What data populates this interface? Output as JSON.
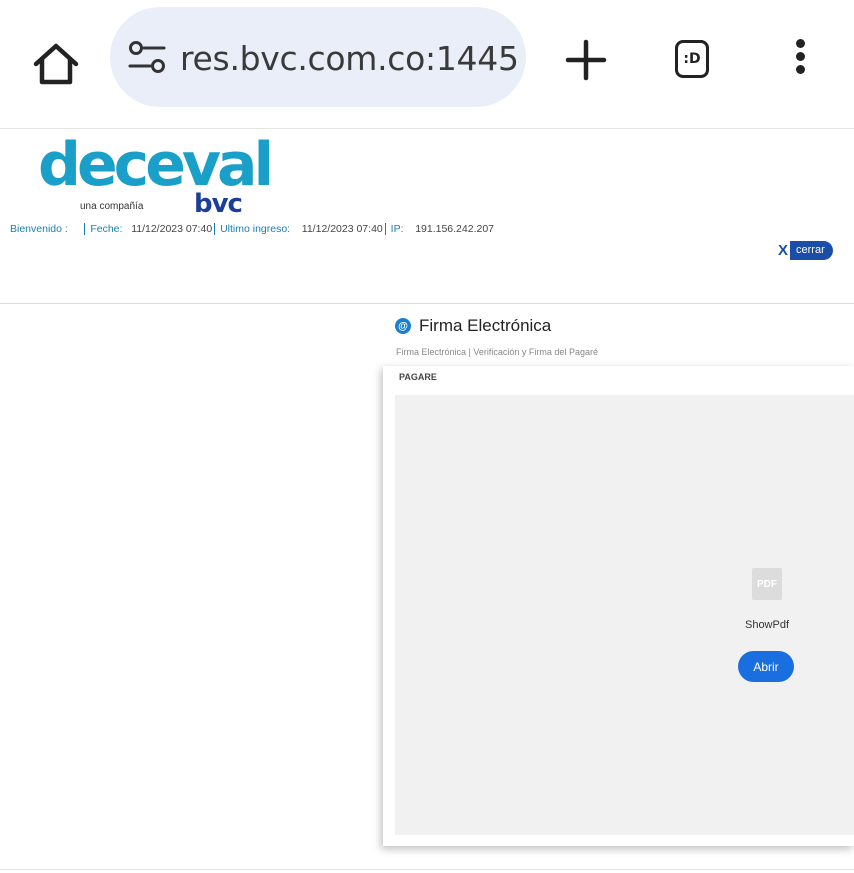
{
  "browser": {
    "url": "res.bvc.com.co:1445",
    "tab_label": ":D",
    "icons": [
      "home-icon",
      "tune-icon",
      "plus-icon",
      "tab-switcher-icon",
      "more-vert-icon"
    ]
  },
  "header": {
    "logo_word": "deceval",
    "logo_sub": "una compañía",
    "logo_bvc": "bvc",
    "welcome_label": "Bienvenido :",
    "date_label": "Feche:",
    "date_value": "11/12/2023 07:40",
    "last_login_label": "Ultimo ingreso:",
    "last_login_value": "11/12/2023 07:40",
    "ip_label": "IP:",
    "ip_value": "191.156.242.207",
    "logout_x": "X",
    "logout_label": "cerrar",
    "accent_color": "#1a4ea8"
  },
  "content": {
    "title": "Firma Electrónica",
    "breadcrumb": [
      "Firma Electrónica",
      "Verificación y Firma del Pagaré"
    ],
    "breadcrumb_sep": "|",
    "panel_label": "PAGARE",
    "pdf_icon_text": "PDF",
    "pdf_name": "ShowPdf",
    "open_button": "Abrir"
  }
}
